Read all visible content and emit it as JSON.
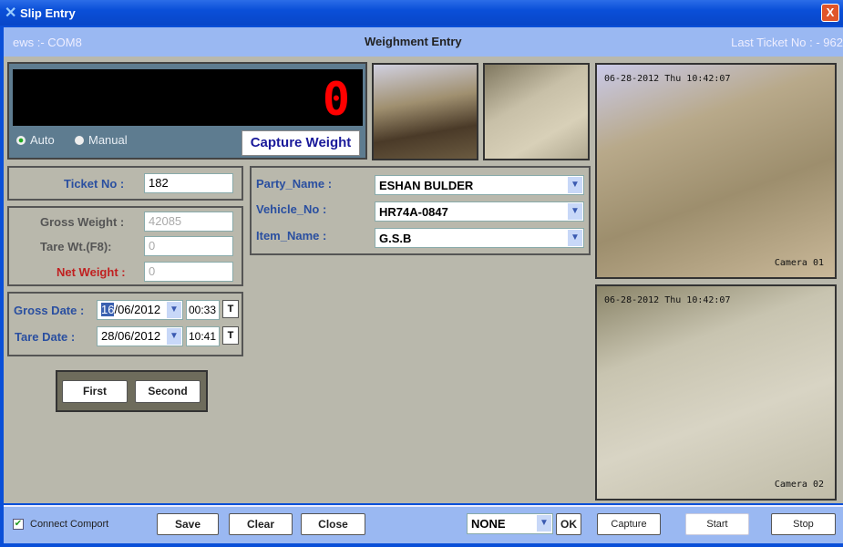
{
  "window": {
    "title": "Slip Entry",
    "close": "X"
  },
  "header": {
    "port": "ews :- COM8",
    "title": "Weighment Entry",
    "last_ticket": "Last Ticket No : - 962"
  },
  "weight": {
    "display": "0",
    "mode_auto": "Auto",
    "mode_manual": "Manual",
    "selected_mode": "Auto",
    "capture": "Capture Weight"
  },
  "cameras": {
    "timestamp": "06-28-2012 Thu 10:42:07",
    "cam1": "Camera 01",
    "cam2": "Camera 02"
  },
  "ticket": {
    "label": "Ticket No :",
    "value": "182"
  },
  "weights": {
    "gross_label": "Gross Weight :",
    "gross": "42085",
    "tare_label": "Tare Wt.(F8):",
    "tare": "0",
    "net_label": "Net Weight :",
    "net": "0"
  },
  "dates": {
    "gross_label": "Gross Date :",
    "gross_day": "16",
    "gross_rest": "/06/2012",
    "gross_time": "00:33",
    "tare_label": "Tare Date :",
    "tare_date": "28/06/2012",
    "tare_time": "10:41",
    "t": "T"
  },
  "details": {
    "party_label": "Party_Name :",
    "party": "ESHAN BULDER",
    "vehicle_label": "Vehicle_No :",
    "vehicle": "HR74A-0847",
    "item_label": "Item_Name :",
    "item": "G.S.B"
  },
  "weighing": {
    "first": "First",
    "second": "Second"
  },
  "footer": {
    "connect": "Connect Comport",
    "connect_checked": true,
    "save": "Save",
    "clear": "Clear",
    "close": "Close",
    "camera_select": "NONE",
    "ok": "OK",
    "capture": "Capture",
    "start": "Start",
    "stop": "Stop"
  }
}
